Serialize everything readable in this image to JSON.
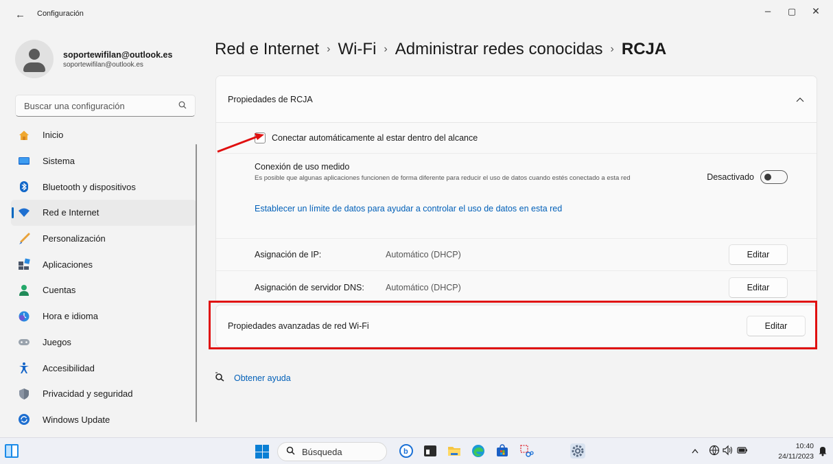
{
  "window": {
    "title": "Configuración",
    "back_icon": "back-arrow-icon",
    "minimize": "–",
    "maximize": "▢",
    "close": "✕"
  },
  "profile": {
    "name": "soportewifilan@outlook.es",
    "email": "soportewifilan@outlook.es"
  },
  "search": {
    "placeholder": "Buscar una configuración"
  },
  "nav": {
    "active_index": 3,
    "items": [
      {
        "label": "Inicio",
        "icon": "home-icon"
      },
      {
        "label": "Sistema",
        "icon": "system-icon"
      },
      {
        "label": "Bluetooth y dispositivos",
        "icon": "bluetooth-icon"
      },
      {
        "label": "Red e Internet",
        "icon": "wifi-icon"
      },
      {
        "label": "Personalización",
        "icon": "brush-icon"
      },
      {
        "label": "Aplicaciones",
        "icon": "apps-icon"
      },
      {
        "label": "Cuentas",
        "icon": "accounts-icon"
      },
      {
        "label": "Hora e idioma",
        "icon": "time-language-icon"
      },
      {
        "label": "Juegos",
        "icon": "gamepad-icon"
      },
      {
        "label": "Accesibilidad",
        "icon": "accessibility-icon"
      },
      {
        "label": "Privacidad y seguridad",
        "icon": "shield-icon"
      },
      {
        "label": "Windows Update",
        "icon": "update-icon"
      }
    ]
  },
  "breadcrumb": {
    "items": [
      "Red e Internet",
      "Wi-Fi",
      "Administrar redes conocidas"
    ],
    "separator": "›",
    "current": "RCJA"
  },
  "properties": {
    "header": "Propiedades de RCJA",
    "auto_connect": {
      "label": "Conectar automáticamente al estar dentro del alcance",
      "checked": false
    },
    "metered": {
      "title": "Conexión de uso medido",
      "description": "Es posible que algunas aplicaciones funcionen de forma diferente para reducir el uso de datos cuando estés conectado a esta red",
      "toggle_label": "Desactivado",
      "toggle_on": false,
      "link": "Establecer un límite de datos para ayudar a controlar el uso de datos en esta red"
    },
    "ip": {
      "label": "Asignación de IP:",
      "value": "Automático (DHCP)",
      "button": "Editar"
    },
    "dns": {
      "label": "Asignación de servidor DNS:",
      "value": "Automático (DHCP)",
      "button": "Editar"
    }
  },
  "advanced": {
    "label": "Propiedades avanzadas de red Wi-Fi",
    "button": "Editar"
  },
  "help": {
    "label": "Obtener ayuda"
  },
  "annotation": {
    "box_color": "#e01010",
    "arrow_color": "#e01010"
  },
  "taskbar": {
    "search_label": "Búsqueda",
    "apps": [
      "bing-chat-icon",
      "terminal-icon",
      "file-explorer-icon",
      "edge-icon",
      "store-icon",
      "snipping-tool-icon",
      "settings-icon"
    ],
    "tray_icons": [
      "chevron-up-icon",
      "network-icon",
      "volume-icon",
      "battery-icon"
    ],
    "time": "10:40",
    "date": "24/11/2023"
  },
  "colors": {
    "accent": "#0067c0",
    "link": "#005fb8",
    "background": "#f3f3f3"
  }
}
